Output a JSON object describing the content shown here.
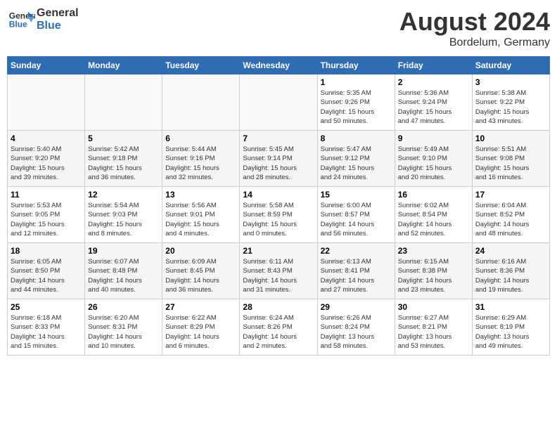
{
  "header": {
    "logo_line1": "General",
    "logo_line2": "Blue",
    "month": "August 2024",
    "location": "Bordelum, Germany"
  },
  "days_of_week": [
    "Sunday",
    "Monday",
    "Tuesday",
    "Wednesday",
    "Thursday",
    "Friday",
    "Saturday"
  ],
  "weeks": [
    [
      {
        "day": "",
        "info": ""
      },
      {
        "day": "",
        "info": ""
      },
      {
        "day": "",
        "info": ""
      },
      {
        "day": "",
        "info": ""
      },
      {
        "day": "1",
        "info": "Sunrise: 5:35 AM\nSunset: 9:26 PM\nDaylight: 15 hours\nand 50 minutes."
      },
      {
        "day": "2",
        "info": "Sunrise: 5:36 AM\nSunset: 9:24 PM\nDaylight: 15 hours\nand 47 minutes."
      },
      {
        "day": "3",
        "info": "Sunrise: 5:38 AM\nSunset: 9:22 PM\nDaylight: 15 hours\nand 43 minutes."
      }
    ],
    [
      {
        "day": "4",
        "info": "Sunrise: 5:40 AM\nSunset: 9:20 PM\nDaylight: 15 hours\nand 39 minutes."
      },
      {
        "day": "5",
        "info": "Sunrise: 5:42 AM\nSunset: 9:18 PM\nDaylight: 15 hours\nand 36 minutes."
      },
      {
        "day": "6",
        "info": "Sunrise: 5:44 AM\nSunset: 9:16 PM\nDaylight: 15 hours\nand 32 minutes."
      },
      {
        "day": "7",
        "info": "Sunrise: 5:45 AM\nSunset: 9:14 PM\nDaylight: 15 hours\nand 28 minutes."
      },
      {
        "day": "8",
        "info": "Sunrise: 5:47 AM\nSunset: 9:12 PM\nDaylight: 15 hours\nand 24 minutes."
      },
      {
        "day": "9",
        "info": "Sunrise: 5:49 AM\nSunset: 9:10 PM\nDaylight: 15 hours\nand 20 minutes."
      },
      {
        "day": "10",
        "info": "Sunrise: 5:51 AM\nSunset: 9:08 PM\nDaylight: 15 hours\nand 16 minutes."
      }
    ],
    [
      {
        "day": "11",
        "info": "Sunrise: 5:53 AM\nSunset: 9:05 PM\nDaylight: 15 hours\nand 12 minutes."
      },
      {
        "day": "12",
        "info": "Sunrise: 5:54 AM\nSunset: 9:03 PM\nDaylight: 15 hours\nand 8 minutes."
      },
      {
        "day": "13",
        "info": "Sunrise: 5:56 AM\nSunset: 9:01 PM\nDaylight: 15 hours\nand 4 minutes."
      },
      {
        "day": "14",
        "info": "Sunrise: 5:58 AM\nSunset: 8:59 PM\nDaylight: 15 hours\nand 0 minutes."
      },
      {
        "day": "15",
        "info": "Sunrise: 6:00 AM\nSunset: 8:57 PM\nDaylight: 14 hours\nand 56 minutes."
      },
      {
        "day": "16",
        "info": "Sunrise: 6:02 AM\nSunset: 8:54 PM\nDaylight: 14 hours\nand 52 minutes."
      },
      {
        "day": "17",
        "info": "Sunrise: 6:04 AM\nSunset: 8:52 PM\nDaylight: 14 hours\nand 48 minutes."
      }
    ],
    [
      {
        "day": "18",
        "info": "Sunrise: 6:05 AM\nSunset: 8:50 PM\nDaylight: 14 hours\nand 44 minutes."
      },
      {
        "day": "19",
        "info": "Sunrise: 6:07 AM\nSunset: 8:48 PM\nDaylight: 14 hours\nand 40 minutes."
      },
      {
        "day": "20",
        "info": "Sunrise: 6:09 AM\nSunset: 8:45 PM\nDaylight: 14 hours\nand 36 minutes."
      },
      {
        "day": "21",
        "info": "Sunrise: 6:11 AM\nSunset: 8:43 PM\nDaylight: 14 hours\nand 31 minutes."
      },
      {
        "day": "22",
        "info": "Sunrise: 6:13 AM\nSunset: 8:41 PM\nDaylight: 14 hours\nand 27 minutes."
      },
      {
        "day": "23",
        "info": "Sunrise: 6:15 AM\nSunset: 8:38 PM\nDaylight: 14 hours\nand 23 minutes."
      },
      {
        "day": "24",
        "info": "Sunrise: 6:16 AM\nSunset: 8:36 PM\nDaylight: 14 hours\nand 19 minutes."
      }
    ],
    [
      {
        "day": "25",
        "info": "Sunrise: 6:18 AM\nSunset: 8:33 PM\nDaylight: 14 hours\nand 15 minutes."
      },
      {
        "day": "26",
        "info": "Sunrise: 6:20 AM\nSunset: 8:31 PM\nDaylight: 14 hours\nand 10 minutes."
      },
      {
        "day": "27",
        "info": "Sunrise: 6:22 AM\nSunset: 8:29 PM\nDaylight: 14 hours\nand 6 minutes."
      },
      {
        "day": "28",
        "info": "Sunrise: 6:24 AM\nSunset: 8:26 PM\nDaylight: 14 hours\nand 2 minutes."
      },
      {
        "day": "29",
        "info": "Sunrise: 6:26 AM\nSunset: 8:24 PM\nDaylight: 13 hours\nand 58 minutes."
      },
      {
        "day": "30",
        "info": "Sunrise: 6:27 AM\nSunset: 8:21 PM\nDaylight: 13 hours\nand 53 minutes."
      },
      {
        "day": "31",
        "info": "Sunrise: 6:29 AM\nSunset: 8:19 PM\nDaylight: 13 hours\nand 49 minutes."
      }
    ]
  ]
}
